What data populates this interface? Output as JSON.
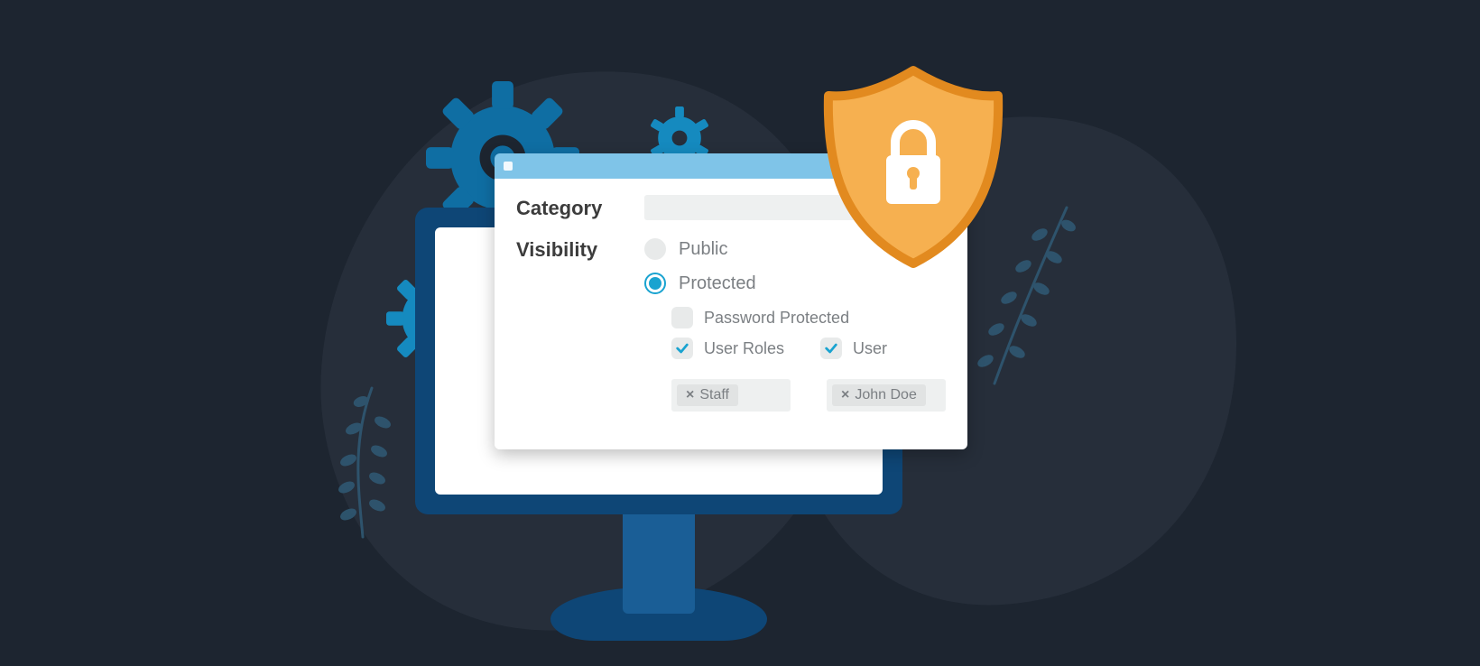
{
  "form": {
    "category": {
      "label": "Category",
      "value": ""
    },
    "visibility": {
      "label": "Visibility",
      "options": {
        "public": {
          "label": "Public",
          "selected": false
        },
        "protected": {
          "label": "Protected",
          "selected": true
        }
      },
      "sub": {
        "password_protected": {
          "label": "Password Protected",
          "checked": false
        },
        "user_roles": {
          "label": "User Roles",
          "checked": true
        },
        "user": {
          "label": "User",
          "checked": true
        }
      },
      "chips": {
        "roles": [
          "Staff"
        ],
        "users": [
          "John Doe"
        ]
      }
    }
  },
  "colors": {
    "accent": "#19a3d0",
    "shield_fill": "#f6b050",
    "shield_stroke": "#e28a1f",
    "bg": "#1d2530",
    "blob": "#262e3a"
  }
}
